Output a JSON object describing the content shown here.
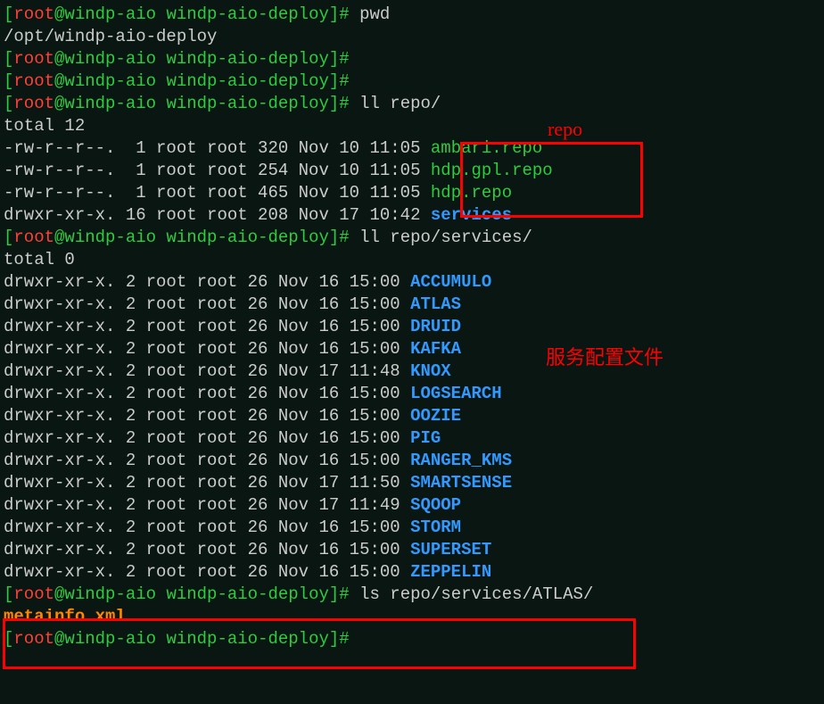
{
  "prompt": {
    "open": "[",
    "user": "root",
    "at": "@",
    "host": "windp-aio",
    "path": " windp-aio-deploy",
    "close": "]#"
  },
  "cmd_pwd": " pwd",
  "out_pwd": "/opt/windp-aio-deploy",
  "cmd_ll_repo": " ll repo/",
  "ll_repo_total": "total 12",
  "repo_files": [
    {
      "perm": "-rw-r--r--.  1 root root 320 Nov 10 11:05 ",
      "name": "ambari.repo"
    },
    {
      "perm": "-rw-r--r--.  1 root root 254 Nov 10 11:05 ",
      "name": "hdp.gpl.repo"
    },
    {
      "perm": "-rw-r--r--.  1 root root 465 Nov 10 11:05 ",
      "name": "hdp.repo"
    }
  ],
  "repo_dir": {
    "perm": "drwxr-xr-x. 16 root root 208 Nov 17 10:42 ",
    "name": "services"
  },
  "cmd_ll_services": " ll repo/services/",
  "ll_services_total": "total 0",
  "services": [
    {
      "perm": "drwxr-xr-x. 2 root root 26 Nov 16 15:00 ",
      "name": "ACCUMULO"
    },
    {
      "perm": "drwxr-xr-x. 2 root root 26 Nov 16 15:00 ",
      "name": "ATLAS"
    },
    {
      "perm": "drwxr-xr-x. 2 root root 26 Nov 16 15:00 ",
      "name": "DRUID"
    },
    {
      "perm": "drwxr-xr-x. 2 root root 26 Nov 16 15:00 ",
      "name": "KAFKA"
    },
    {
      "perm": "drwxr-xr-x. 2 root root 26 Nov 17 11:48 ",
      "name": "KNOX"
    },
    {
      "perm": "drwxr-xr-x. 2 root root 26 Nov 16 15:00 ",
      "name": "LOGSEARCH"
    },
    {
      "perm": "drwxr-xr-x. 2 root root 26 Nov 16 15:00 ",
      "name": "OOZIE"
    },
    {
      "perm": "drwxr-xr-x. 2 root root 26 Nov 16 15:00 ",
      "name": "PIG"
    },
    {
      "perm": "drwxr-xr-x. 2 root root 26 Nov 16 15:00 ",
      "name": "RANGER_KMS"
    },
    {
      "perm": "drwxr-xr-x. 2 root root 26 Nov 17 11:50 ",
      "name": "SMARTSENSE"
    },
    {
      "perm": "drwxr-xr-x. 2 root root 26 Nov 17 11:49 ",
      "name": "SQOOP"
    },
    {
      "perm": "drwxr-xr-x. 2 root root 26 Nov 16 15:00 ",
      "name": "STORM"
    },
    {
      "perm": "drwxr-xr-x. 2 root root 26 Nov 16 15:00 ",
      "name": "SUPERSET"
    },
    {
      "perm": "drwxr-xr-x. 2 root root 26 Nov 16 15:00 ",
      "name": "ZEPPELIN"
    }
  ],
  "cmd_ls_atlas": " ls repo/services/ATLAS/",
  "out_ls_atlas": "metainfo.xml",
  "annotations": {
    "repo_label": "repo",
    "services_label": "服务配置文件"
  }
}
